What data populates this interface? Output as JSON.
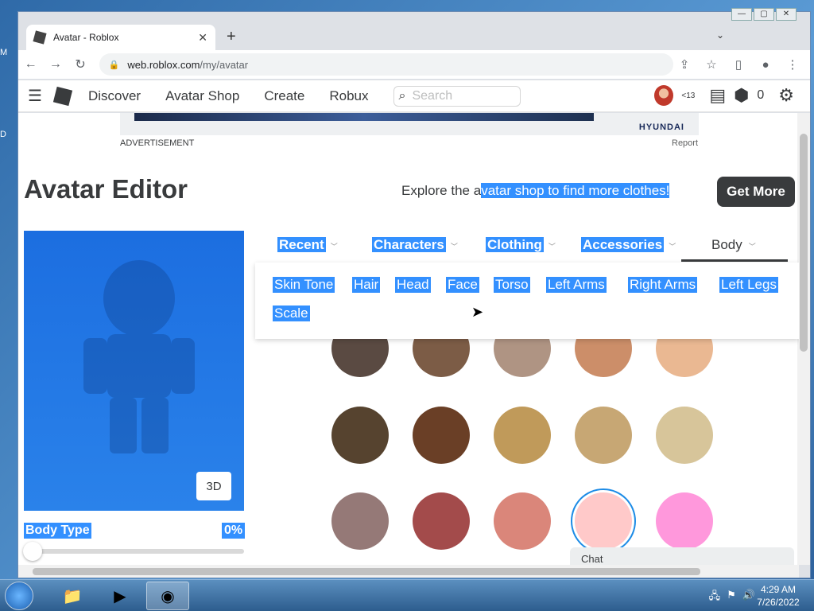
{
  "desktop": {
    "frag1": "M",
    "frag2": "D"
  },
  "window_caps": {
    "min": "—",
    "max": "▢",
    "close": "✕"
  },
  "browser": {
    "tab_title": "Avatar - Roblox",
    "tab_close": "✕",
    "new_tab": "+",
    "tab_list": "⌄",
    "url_host": "web.roblox.com",
    "url_path": "/my/avatar",
    "back": "←",
    "forward": "→",
    "reload": "↻",
    "share": "⇪",
    "star": "☆",
    "sidebar": "▯",
    "profile": "●",
    "menu": "⋮"
  },
  "nav": {
    "menu_icon": "☰",
    "links": [
      "Discover",
      "Avatar Shop",
      "Create",
      "Robux"
    ],
    "search_placeholder": "Search",
    "age_badge": "<13",
    "robux_count": "0"
  },
  "ad": {
    "label": "ADVERTISEMENT",
    "report": "Report",
    "brand": "HYUNDAI"
  },
  "page": {
    "title": "Avatar Editor",
    "explore_plain": "Explore the a",
    "explore_highlight": "vatar shop to find more clothes!",
    "get_more": "Get More",
    "view_3d": "3D",
    "body_type_label": "Body Type",
    "body_type_value": "0%",
    "body_type_level": 0
  },
  "categories": [
    {
      "label": "Recent",
      "active": false
    },
    {
      "label": "Characters",
      "active": false
    },
    {
      "label": "Clothing",
      "active": false
    },
    {
      "label": "Accessories",
      "active": false
    },
    {
      "label": "Body",
      "active": true
    }
  ],
  "body_menu": [
    "Skin Tone",
    "Hair",
    "Head",
    "Face",
    "Torso",
    "Left Arms",
    "Right Arms",
    "Left Legs",
    "Scale"
  ],
  "skin_tones": [
    {
      "color": "#5a4a42",
      "selected": false
    },
    {
      "color": "#7c5c46",
      "selected": false
    },
    {
      "color": "#af9483",
      "selected": false
    },
    {
      "color": "#cc8e69",
      "selected": false
    },
    {
      "color": "#eab892",
      "selected": false
    },
    {
      "color": "#56432f",
      "selected": false
    },
    {
      "color": "#6a3f26",
      "selected": false
    },
    {
      "color": "#c09a5a",
      "selected": false
    },
    {
      "color": "#c7a774",
      "selected": false
    },
    {
      "color": "#d7c59a",
      "selected": false
    },
    {
      "color": "#957977",
      "selected": false
    },
    {
      "color": "#a34b4b",
      "selected": false
    },
    {
      "color": "#da867a",
      "selected": false
    },
    {
      "color": "#ffc9c9",
      "selected": true
    },
    {
      "color": "#ff98dc",
      "selected": false
    }
  ],
  "chat": {
    "label": "Chat"
  },
  "taskbar": {
    "apps": [
      "file-explorer",
      "media-player",
      "chrome"
    ],
    "time": "4:29 AM",
    "date": "7/26/2022"
  },
  "colors": {
    "accent": "#3390ff",
    "dark": "#393b3d",
    "selection_ring": "#1c8be6"
  }
}
